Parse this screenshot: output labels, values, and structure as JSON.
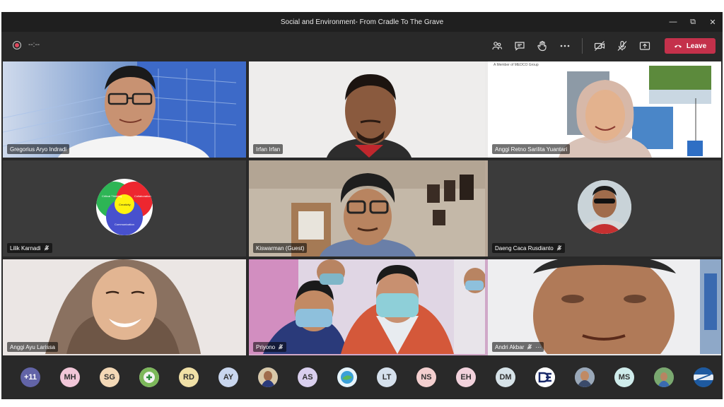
{
  "window": {
    "title": "Social and Environment- From Cradle To The Grave"
  },
  "toolbar": {
    "timer": "--:--",
    "leave_label": "Leave"
  },
  "participants": [
    {
      "name": "Gregorius Aryo Indradi",
      "muted": false
    },
    {
      "name": "Irfan Irfan",
      "muted": false
    },
    {
      "name": "Anggi Retno Sarilita Yuantari",
      "muted": false
    },
    {
      "name": "Lilik Karnadi",
      "muted": true
    },
    {
      "name": "Kiswarman (Guest)",
      "muted": false
    },
    {
      "name": "Daeng Caca Rusdianto",
      "muted": true
    },
    {
      "name": "Anggi Ayu Larissa",
      "muted": false
    },
    {
      "name": "Priyono",
      "muted": true
    },
    {
      "name": "Andri Akbar",
      "muted": true,
      "more": "···"
    }
  ],
  "shared_slide": {
    "header": "A Member of MEDCO Group",
    "venn_labels": [
      "Critical Thinking",
      "Collaboration",
      "Creativity",
      "Communication"
    ]
  },
  "roster": [
    {
      "initials": "+11",
      "color": "#6264a7"
    },
    {
      "initials": "MH",
      "color": "#f1c6d8"
    },
    {
      "initials": "SG",
      "color": "#f3d8b6"
    },
    {
      "initials": "",
      "color": "#8fbf6a",
      "photo": true
    },
    {
      "initials": "RD",
      "color": "#f0e0a6"
    },
    {
      "initials": "AY",
      "color": "#c9d6ee"
    },
    {
      "initials": "",
      "color": "#3b5aa0",
      "photo": true
    },
    {
      "initials": "AS",
      "color": "#d9cfee"
    },
    {
      "initials": "",
      "color": "#4c9ad8",
      "photo": true
    },
    {
      "initials": "LT",
      "color": "#d5e0ec"
    },
    {
      "initials": "NS",
      "color": "#f3cfcf"
    },
    {
      "initials": "EH",
      "color": "#f2d2dc"
    },
    {
      "initials": "DM",
      "color": "#d6e2e8"
    },
    {
      "initials": "",
      "color": "#ffffff",
      "photo": true
    },
    {
      "initials": "",
      "color": "#7a8fa8",
      "photo": true
    },
    {
      "initials": "MS",
      "color": "#cfeceb"
    },
    {
      "initials": "",
      "color": "#5f8a5a",
      "photo": true
    },
    {
      "initials": "",
      "color": "#2a6fb0",
      "photo": true
    }
  ]
}
